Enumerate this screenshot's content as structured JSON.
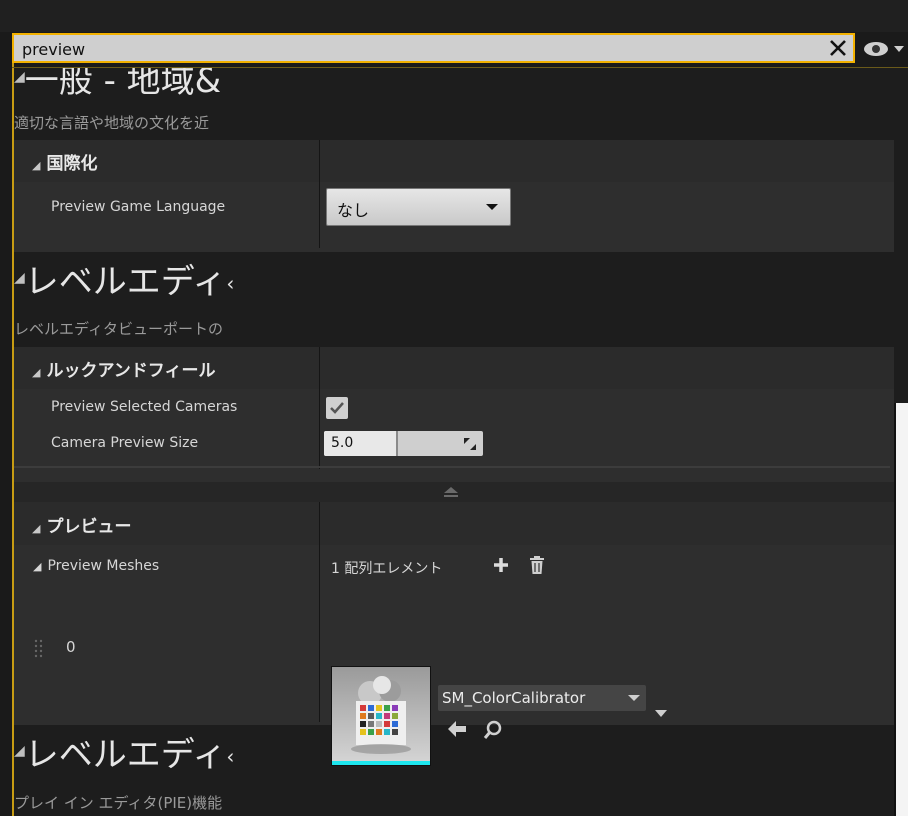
{
  "search": {
    "value": "preview"
  },
  "categories": [
    {
      "title": "一般 - 地域&",
      "description": "適切な言語や地域の文化を近"
    },
    {
      "title": "レベルエディ",
      "description": "レベルエディタビューポートの"
    },
    {
      "title": "レベルエディ",
      "description": "プレイ イン エディタ(PIE)機能"
    }
  ],
  "sections": {
    "i18n": {
      "header": "国際化",
      "preview_game_language": {
        "label": "Preview Game Language",
        "value": "なし"
      }
    },
    "look_and_feel": {
      "header": "ルックアンドフィール",
      "preview_selected_cameras": {
        "label": "Preview Selected Cameras",
        "checked": true
      },
      "camera_preview_size": {
        "label": "Camera Preview Size",
        "value": "5.0",
        "fill_fraction": 0.45
      }
    },
    "preview": {
      "header": "プレビュー",
      "preview_meshes": {
        "label": "Preview Meshes",
        "count_text": "1 配列エレメント"
      },
      "element": {
        "index": "0",
        "asset": "SM_ColorCalibrator"
      }
    }
  },
  "icons": {
    "clear": "close-icon",
    "visibility": "eye-icon",
    "add": "plus-icon",
    "remove": "trash-icon",
    "use": "arrow-left-icon",
    "browse": "search-icon",
    "reorder": "grip-icon"
  },
  "colors": {
    "search_border": "#f2b100",
    "panel_bg": "#1d1d1d",
    "section_bg": "#2e2e2e",
    "thumbnail_bar": "#1ee6ee"
  }
}
